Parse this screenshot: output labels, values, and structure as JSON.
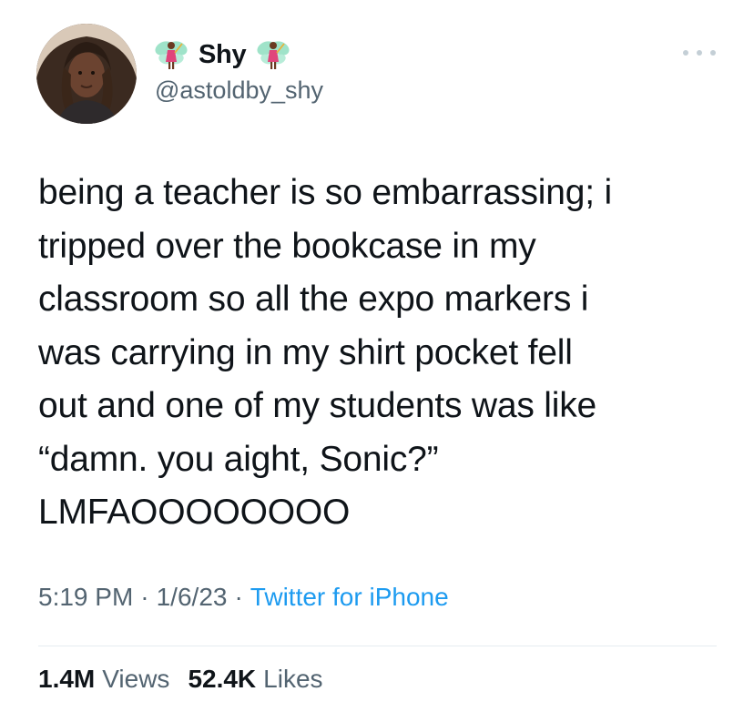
{
  "tweet": {
    "author": {
      "display_name": "Shy",
      "handle": "@astoldby_shy",
      "name_decoration_icon": "fairy-emoji"
    },
    "text": "being a teacher is so embarrassing; i\ntripped over the bookcase in my\nclassroom so all the expo markers i\nwas carrying in my shirt pocket fell\nout and one of my students was like\n“damn. you aight, Sonic?”\nLMFAOOOOOOOO",
    "time": "5:19 PM",
    "separator": "·",
    "date": "1/6/23",
    "source": "Twitter for iPhone",
    "views_count": "1.4M",
    "views_label": "Views",
    "likes_count": "52.4K",
    "likes_label": "Likes"
  },
  "icons": {
    "more": "more-horizontal-icon"
  },
  "colors": {
    "text_primary": "#0f1419",
    "text_secondary": "#536471",
    "link": "#1d9bf0",
    "divider": "#e6ecf0",
    "more_icon": "#c4cfd6"
  }
}
